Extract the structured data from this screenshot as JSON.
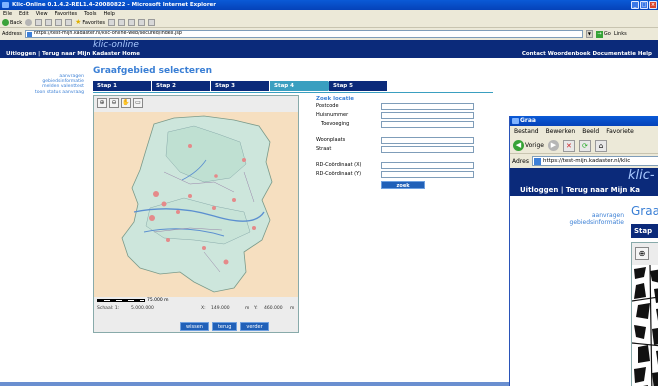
{
  "win1": {
    "title": "Klic-Online 0.1.4.2-REL1.4-20080822 - Microsoft Internet Explorer",
    "menu": [
      "Eile",
      "Edit",
      "View",
      "Favorites",
      "Tools",
      "Help"
    ],
    "toolbar": {
      "back": "Back",
      "favorites": "Favorites"
    },
    "address_label": "Address",
    "address_url": "https://test-mijn.kadaster.nl/klic-online-web/secured/index.jsp",
    "go_label": "Go",
    "links_label": "Links"
  },
  "page": {
    "logo": "klic-online",
    "nav_left": "Uitloggen | Terug naar Mijn Kadaster   Home",
    "nav_right": "Contact   Woordenboek   Documentatie   Help",
    "sidebar": [
      "aanvragen",
      "gebiedsinformatie",
      "melden valenttest",
      "toon status aanvraag"
    ],
    "title": "Graafgebied selecteren",
    "steps": [
      "Stap 1",
      "Stap 2",
      "Stap 3",
      "Stap 4",
      "Stap 5"
    ],
    "active_step": 3,
    "map": {
      "scale_label": "75.000 m",
      "schaal_label": "Schaal: 1:",
      "schaal_value": "5.000.000",
      "x_label": "X:",
      "x_value": "149.000",
      "x_unit": "m",
      "y_label": "Y:",
      "y_value": "460.000",
      "y_unit": "m",
      "buttons": [
        "wissen",
        "terug",
        "verder"
      ]
    },
    "form": {
      "header": "Zoek locatie",
      "fields": [
        "Postcode",
        "Huisnummer",
        "Toevoeging",
        "Woonplaats",
        "Straat",
        "RD-Coördinaat (X)",
        "RD-Coördinaat (Y)"
      ],
      "submit": "zoek"
    }
  },
  "win2": {
    "title": "Graa",
    "menu": [
      "Bestand",
      "Bewerken",
      "Beeld",
      "Favoriete"
    ],
    "back": "Vorige",
    "address_label": "Adres",
    "address_url": "https://test-mijn.kadaster.nl/klic",
    "logo": "klic-",
    "nav": "Uitloggen | Terug naar Mijn Ka",
    "sidebar": [
      "aanvragen",
      "gebiedsinformatie"
    ],
    "step": "Stap"
  }
}
